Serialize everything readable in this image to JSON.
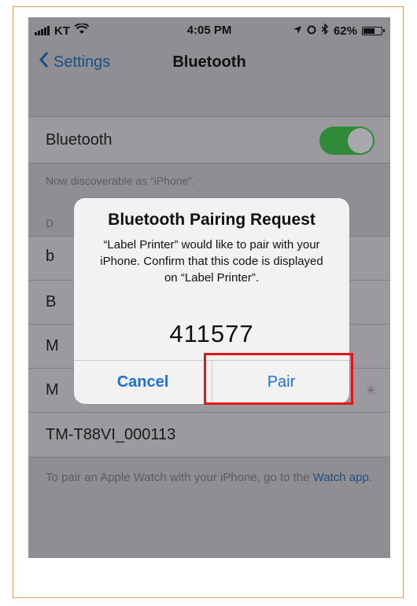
{
  "status_bar": {
    "carrier": "KT",
    "time": "4:05 PM",
    "battery_percent": "62%"
  },
  "nav": {
    "back_label": "Settings",
    "title": "Bluetooth"
  },
  "bluetooth_row": {
    "label": "Bluetooth",
    "toggle_on": true
  },
  "discoverable_note": "Now discoverable as “iPhone”.",
  "devices_header_partial": "D",
  "device_rows": [
    {
      "partial_label": "b"
    },
    {
      "partial_label": "B"
    },
    {
      "partial_label": "M"
    },
    {
      "partial_label": "M"
    }
  ],
  "device_last": "TM-T88VI_000113",
  "dialog": {
    "title": "Bluetooth Pairing Request",
    "message": "“Label Printer” would like to pair with your iPhone. Confirm that this code is displayed on “Label Printer”.",
    "code": "411577",
    "cancel_label": "Cancel",
    "pair_label": "Pair"
  },
  "footer": {
    "text_before_link": "To pair an Apple Watch with your iPhone, go to the ",
    "link_text": "Watch app",
    "text_after_link": "."
  },
  "colors": {
    "accent": "#1f6fd4",
    "toggle_on": "#2f8a3a",
    "highlight": "#e2161a"
  }
}
